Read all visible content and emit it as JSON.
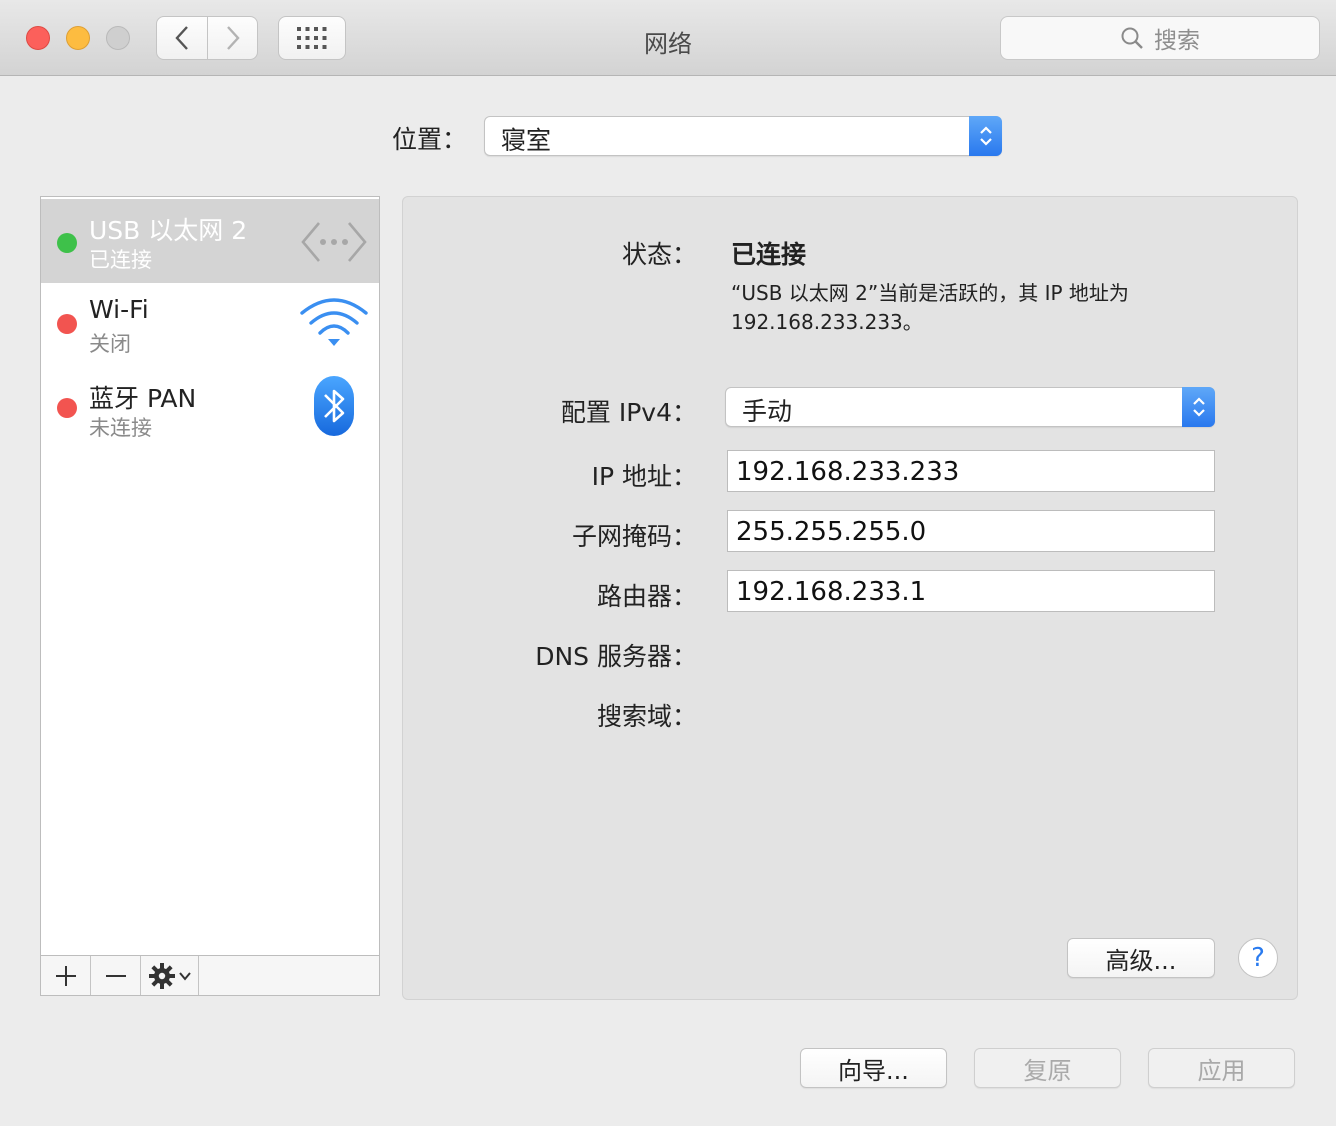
{
  "window": {
    "title": "网络",
    "search_placeholder": "搜索"
  },
  "location": {
    "label": "位置：",
    "value": "寝室"
  },
  "services": [
    {
      "name": "USB 以太网 2",
      "status": "已连接",
      "dot_color": "#3ec14a",
      "icon": "ethernet-icon",
      "selected": true
    },
    {
      "name": "Wi-Fi",
      "status": "关闭",
      "dot_color": "#f25450",
      "icon": "wifi-icon",
      "selected": false
    },
    {
      "name": "蓝牙 PAN",
      "status": "未连接",
      "dot_color": "#f25450",
      "icon": "bluetooth-icon",
      "selected": false
    }
  ],
  "sidebar_toolbar": {
    "add": "+",
    "remove": "−"
  },
  "detail": {
    "status_label": "状态：",
    "status_value": "已连接",
    "status_desc_line1": "“USB 以太网 2”当前是活跃的，其 IP 地址为",
    "status_desc_line2": "192.168.233.233。",
    "config_label": "配置 IPv4：",
    "config_value": "手动",
    "ip_label": "IP 地址：",
    "ip_value": "192.168.233.233",
    "subnet_label": "子网掩码：",
    "subnet_value": "255.255.255.0",
    "router_label": "路由器：",
    "router_value": "192.168.233.1",
    "dns_label": "DNS 服务器：",
    "search_domain_label": "搜索域：",
    "advanced_button": "高级...",
    "help_button": "?"
  },
  "footer": {
    "assist_button": "向导...",
    "revert_button": "复原",
    "apply_button": "应用"
  }
}
